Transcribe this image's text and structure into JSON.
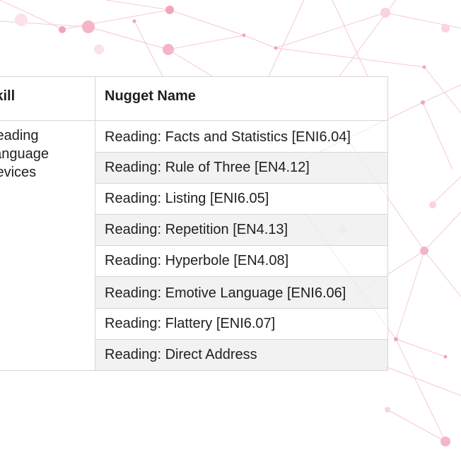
{
  "table": {
    "headers": {
      "skill": "Skill",
      "nugget": "Nugget Name"
    },
    "skill": "Reading Language Devices",
    "nuggets": [
      "Reading: Facts and Statistics [ENI6.04]",
      "Reading: Rule of Three [EN4.12]",
      "Reading: Listing [ENI6.05]",
      "Reading: Repetition [EN4.13]",
      "Reading: Hyperbole [EN4.08]",
      "Reading: Emotive Language [ENI6.06]",
      "Reading: Flattery [ENI6.07]",
      "Reading: Direct Address"
    ]
  },
  "colors": {
    "decor_pink": "#f2a5b8",
    "border": "#d6d6d6",
    "alt_row": "#eeeeee"
  }
}
